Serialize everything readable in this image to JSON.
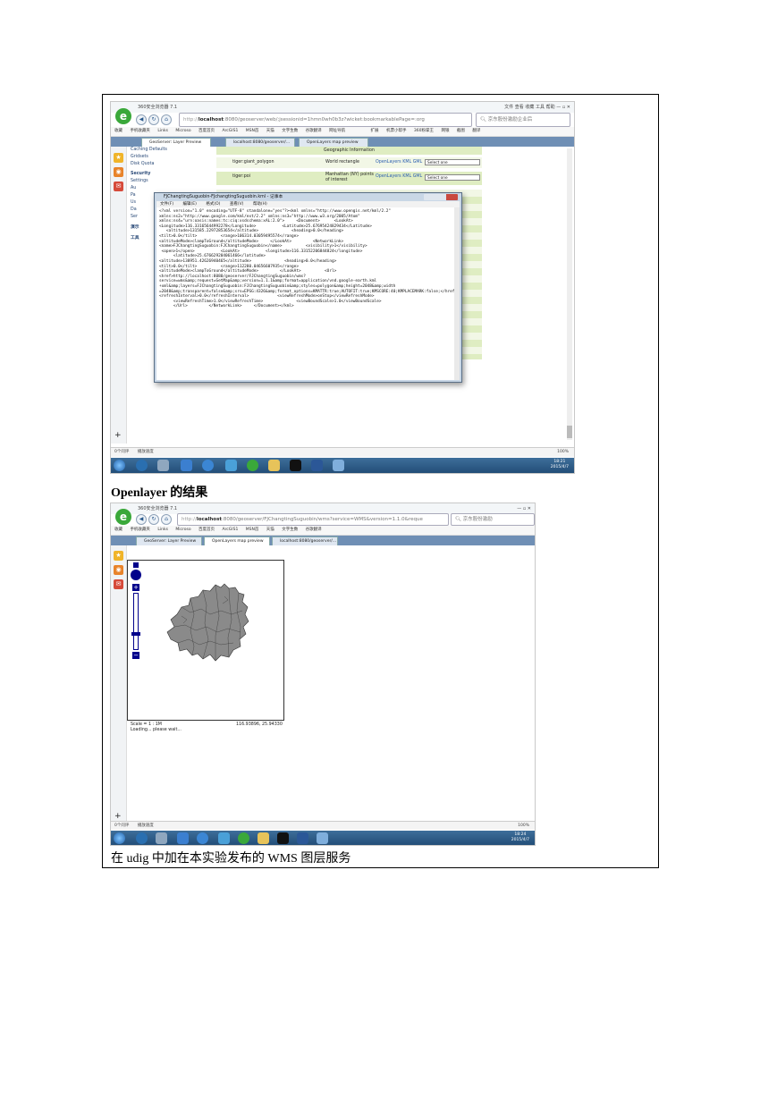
{
  "shot1": {
    "title": "360安全浏览器 7.1",
    "url_host": "localhost",
    "url_rest": ":8080/geoserver/web/;jsessionid=1hmn0wh0b3z?wicket:bookmarkablePage=:org",
    "search_placeholder": "京东股份激励企业后",
    "menu": [
      "文件",
      "查看",
      "收藏",
      "工具",
      "帮助"
    ],
    "favorites": [
      "收藏",
      "手机收藏夹",
      "Links",
      "Microso",
      "百度首页",
      "ArcGIS1",
      "MSN首",
      "天猫",
      "文字生数",
      "谷歌翻译",
      "网址导航"
    ],
    "favorites_right": [
      "扩展",
      "机票小帮手",
      "360粉掌王",
      "网银",
      "截图",
      "翻译"
    ],
    "tabs": [
      "GeoServer: Layer Preview",
      "localhost:8080/geoserver/...",
      "OpenLayers map preview"
    ],
    "sidebar": [
      "Caching Defaults",
      "Gridsets",
      "Disk Quota",
      "Security",
      "Settings",
      "Au",
      "Pa",
      "Us",
      "Da",
      "Ser",
      "演示",
      "工具"
    ],
    "table_header": "Geographic Information",
    "rows": [
      {
        "name": "tiger:giant_polygon",
        "title": "World rectangle",
        "formats": "OpenLayers KML GML",
        "select": "Select one"
      },
      {
        "name": "tiger:poi",
        "title": "Manhattan (NY) points of interest",
        "formats": "OpenLayers KML GML",
        "select": "Select one"
      }
    ],
    "notepad": {
      "title": "FJChangtingSuguobin-FJchangtingSuguobin.kml - 记事本",
      "menu": [
        "文件(F)",
        "编辑(E)",
        "格式(O)",
        "查看(V)",
        "帮助(H)"
      ],
      "content": "<?xml version=\"1.0\" encoding=\"UTF-8\" standalone=\"yes\"?><kml xmlns=\"http://www.opengis.net/kml/2.2\"\nxmlns:ns2=\"http://www.google.com/kml/ext/2.2\" xmlns:ns3=\"http://www.w3.org/2005/Atom\"\nxmlns:ns4=\"urn:oasis:names:tc:ciq:xsdschema:xAL:2.0\">     <Document>      <LookAt>\n<Longitude>116.33165644992278</Longitude>           <Latitude>25.67695424829434</Latitude>\n   <altitude>131585.22972853654</altitude>              <heading>0.0</heading>\n<tilt>0.0</tilt>          <range>106314.03059495574</range>\n<altitudeMode>clampToGround</altitudeMode>     </LookAt>         <NetworkLink>\n<name>FJChangtingSuguobin:FJChangtingSuguobin</name>          <visibility>1</visibility>\n <open>1</open>           <LookAt>           <longitude>116.33152206844824</longitude>\n      <latitude>25.676629204061466</latitude>\n<altitude>138951.42626940465</altitude>              <heading>0.0</heading>\n<tilt>0.0</tilt>          <range>112280.04656607935</range>\n<altitudeMode>clampToGround</altitudeMode>         </LookAt>          <Url>\n<href>http://localhost:8080/geoserver/FJChangtingSuguobin/wms?\nservice=wms&amp;request=GetMap&amp;version=1.1.1&amp;format=application/vnd.google-earth.kml\n+xml&amp;layers=FJChangtingSuguobin:FJChangtingSuguobin&amp;styles=polygon&amp;height=2048&amp;width\n=2048&amp;transparent=false&amp;srs=EPSG:4326&amp;format_options=KMATTR:true;AUTOFIT:true;KMSCORE:40;KMPLACEMARK:false;</href>\n<refreshInterval>0.0</refreshInterval>            <viewRefreshMode>onStop</viewRefreshMode>\n      <viewRefreshTime>1.0</viewRefreshTime>              <viewBoundScale>1.0</viewBoundScale>\n      </Url>         </NetworkLink>     </Document></kml>"
    },
    "status_left": "0个问评",
    "status_left2": "播放速度",
    "status_right": "100%",
    "clock_time": "18:21",
    "clock_date": "2015/4/7"
  },
  "caption1": "Openlayer 的结果",
  "shot2": {
    "title": "360安全浏览器 7.1",
    "url_host": "localhost",
    "url_rest": ":8080/geoserver/FJChangtingSuguobin/wms?service=WMS&version=1.1.0&reque",
    "search_placeholder": "京东股份激励",
    "tabs": [
      "GeoServer: Layer Preview",
      "OpenLayers map preview",
      "localhost:8080/geoserver/..."
    ],
    "scale": "Scale = 1 : 1M",
    "coords": "116.93896, 25.94330",
    "loading": "Loading... please wait...",
    "status_left": "0个问评",
    "status_left2": "播放速度",
    "status_right": "100%",
    "clock_time": "18:24",
    "clock_date": "2015/4/7"
  },
  "caption2": "在 udig 中加在本实验发布的 WMS 图层服务",
  "colors": {
    "accent_green": "#3aa83a",
    "taskbar": "#2b5a8a",
    "row_highlight": "#dfedc2",
    "map_fill": "#8a8a8a"
  }
}
